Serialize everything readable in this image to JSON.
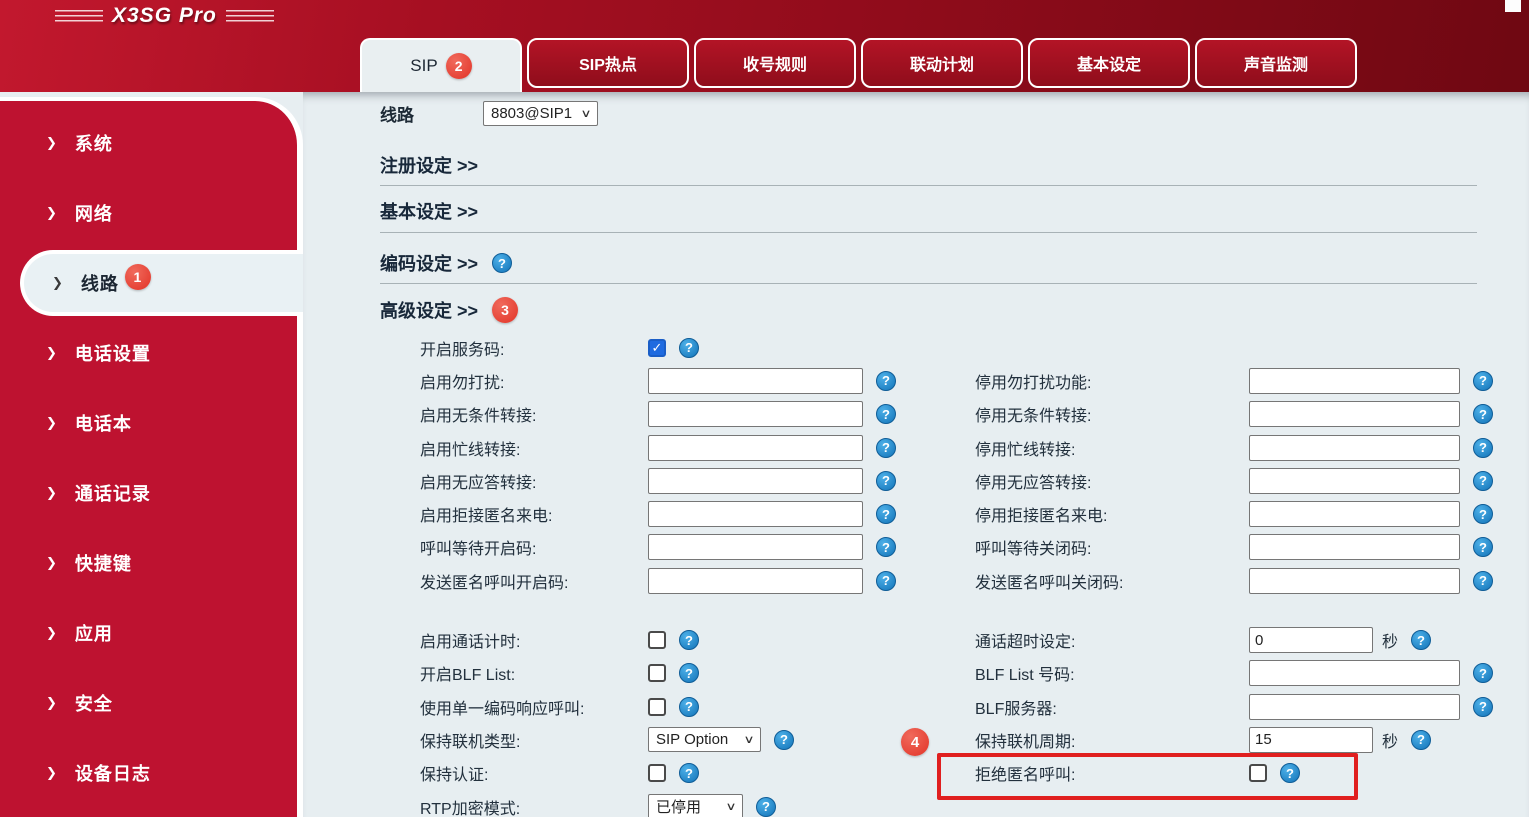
{
  "window": {
    "logo": "X3SG Pro"
  },
  "colors": {
    "banner_red": "#9d0e1e",
    "sidebar_red": "#be1230",
    "content_bg": "#e7eef1",
    "badge_red": "#e23327",
    "help_blue": "#1976bb",
    "checkbox_checked_blue": "#1f6be0",
    "highlight_red": "#e01f1f"
  },
  "tabs": [
    {
      "label": "SIP",
      "badge": "2",
      "active": true
    },
    {
      "label": "SIP热点"
    },
    {
      "label": "收号规则"
    },
    {
      "label": "联动计划"
    },
    {
      "label": "基本设定"
    },
    {
      "label": "声音监测"
    }
  ],
  "sidebar": {
    "items": [
      {
        "label": "系统"
      },
      {
        "label": "网络"
      },
      {
        "label": "线路",
        "badge": "1",
        "active": true
      },
      {
        "label": "电话设置"
      },
      {
        "label": "电话本"
      },
      {
        "label": "通话记录"
      },
      {
        "label": "快捷键"
      },
      {
        "label": "应用"
      },
      {
        "label": "安全"
      },
      {
        "label": "设备日志"
      }
    ]
  },
  "line_selector": {
    "label": "线路",
    "value": "8803@SIP1"
  },
  "sections": [
    {
      "label": "注册设定 >>"
    },
    {
      "label": "基本设定 >>"
    },
    {
      "label": "编码设定 >>",
      "help": true
    },
    {
      "label": "高级设定 >>",
      "badge": "3"
    }
  ],
  "form": {
    "group1_left": [
      {
        "label": "开启服务码:",
        "type": "checkbox",
        "checked": true,
        "help": true
      },
      {
        "label": "启用勿打扰:",
        "type": "text",
        "value": "",
        "help": true
      },
      {
        "label": "启用无条件转接:",
        "type": "text",
        "value": "",
        "help": true
      },
      {
        "label": "启用忙线转接:",
        "type": "text",
        "value": "",
        "help": true
      },
      {
        "label": "启用无应答转接:",
        "type": "text",
        "value": "",
        "help": true
      },
      {
        "label": "启用拒接匿名来电:",
        "type": "text",
        "value": "",
        "help": true
      },
      {
        "label": "呼叫等待开启码:",
        "type": "text",
        "value": "",
        "help": true
      },
      {
        "label": "发送匿名呼叫开启码:",
        "type": "text",
        "value": "",
        "help": true
      }
    ],
    "group1_right": [
      {
        "type": "spacer"
      },
      {
        "label": "停用勿打扰功能:",
        "type": "text",
        "value": "",
        "help": true
      },
      {
        "label": "停用无条件转接:",
        "type": "text",
        "value": "",
        "help": true
      },
      {
        "label": "停用忙线转接:",
        "type": "text",
        "value": "",
        "help": true
      },
      {
        "label": "停用无应答转接:",
        "type": "text",
        "value": "",
        "help": true
      },
      {
        "label": "停用拒接匿名来电:",
        "type": "text",
        "value": "",
        "help": true
      },
      {
        "label": "呼叫等待关闭码:",
        "type": "text",
        "value": "",
        "help": true
      },
      {
        "label": "发送匿名呼叫关闭码:",
        "type": "text",
        "value": "",
        "help": true
      }
    ],
    "group2_left": [
      {
        "label": "启用通话计时:",
        "type": "checkbox",
        "checked": false,
        "help": true
      },
      {
        "label": "开启BLF List:",
        "type": "checkbox",
        "checked": false,
        "help": true
      },
      {
        "label": "使用单一编码响应呼叫:",
        "type": "checkbox",
        "checked": false,
        "help": true
      },
      {
        "label": "保持联机类型:",
        "type": "select",
        "value": "SIP Option",
        "help": true
      },
      {
        "label": "保持认证:",
        "type": "checkbox",
        "checked": false,
        "help": true
      },
      {
        "label": "RTP加密模式:",
        "type": "select",
        "value": "已停用",
        "help": true
      }
    ],
    "group2_right": [
      {
        "label": "通话超时设定:",
        "type": "text",
        "value": "0",
        "unit": "秒",
        "help": true
      },
      {
        "label": "BLF List 号码:",
        "type": "text",
        "value": "",
        "help": true
      },
      {
        "label": "BLF服务器:",
        "type": "text",
        "value": "",
        "help": true
      },
      {
        "label": "保持联机周期:",
        "type": "text",
        "value": "15",
        "unit": "秒",
        "help": true
      },
      {
        "label": "拒绝匿名呼叫:",
        "type": "checkbox",
        "checked": false,
        "help": true,
        "highlighted": true
      }
    ]
  },
  "annotations": {
    "step4": "4"
  }
}
